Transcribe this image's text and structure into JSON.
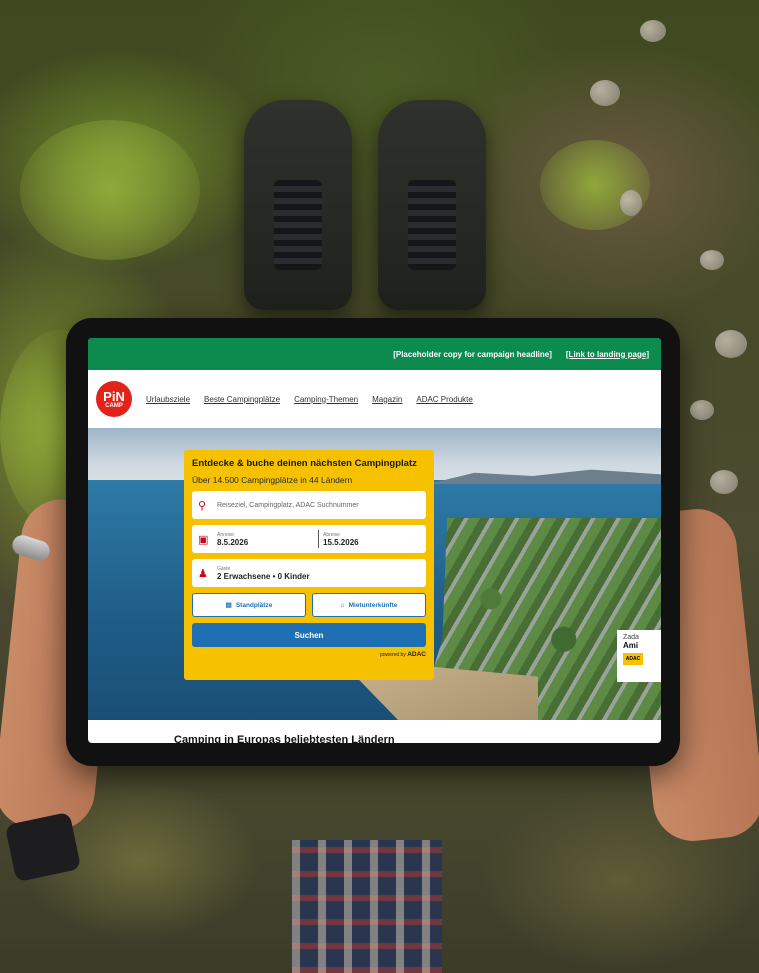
{
  "campaign_bar": {
    "headline": "[Placeholder copy for campaign headline]",
    "link": "[Link to landing page]",
    "color": "#0d8a4e"
  },
  "logo": {
    "line1": "PiN",
    "line2": "CAMP",
    "color": "#e2231a"
  },
  "nav": {
    "items": [
      {
        "label": "Urlaubsziele"
      },
      {
        "label": "Beste Campingplätze"
      },
      {
        "label": "Camping-Themen"
      },
      {
        "label": "Magazin"
      },
      {
        "label": "ADAC Produkte"
      }
    ]
  },
  "search": {
    "title": "Entdecke & buche deinen nächsten Campingplatz",
    "subtitle": "Über 14.500 Campingplätze in 44 Ländern",
    "destination_placeholder": "Reiseziel, Campingplatz, ADAC Suchnummer",
    "arrival_label": "Anreise",
    "arrival_value": "8.5.2026",
    "departure_label": "Abreise",
    "departure_value": "15.5.2026",
    "guests_label": "Gäste",
    "guests_value": "2 Erwachsene • 0 Kinder",
    "pitches_button": "Standplätze",
    "rentals_button": "Mietunterkünfte",
    "search_button": "Suchen",
    "powered_prefix": "powered by",
    "powered_brand": "ADAC",
    "card_color": "#f6c200",
    "accent_color": "#1f6fb5",
    "icons": [
      "search-icon",
      "calendar-icon",
      "guests-icon",
      "pitch-icon",
      "house-icon"
    ]
  },
  "side_badge": {
    "line1": "Zada",
    "line2": "Ami",
    "brand": "ADAC"
  },
  "section": {
    "title": "Camping in Europas beliebtesten Ländern"
  }
}
